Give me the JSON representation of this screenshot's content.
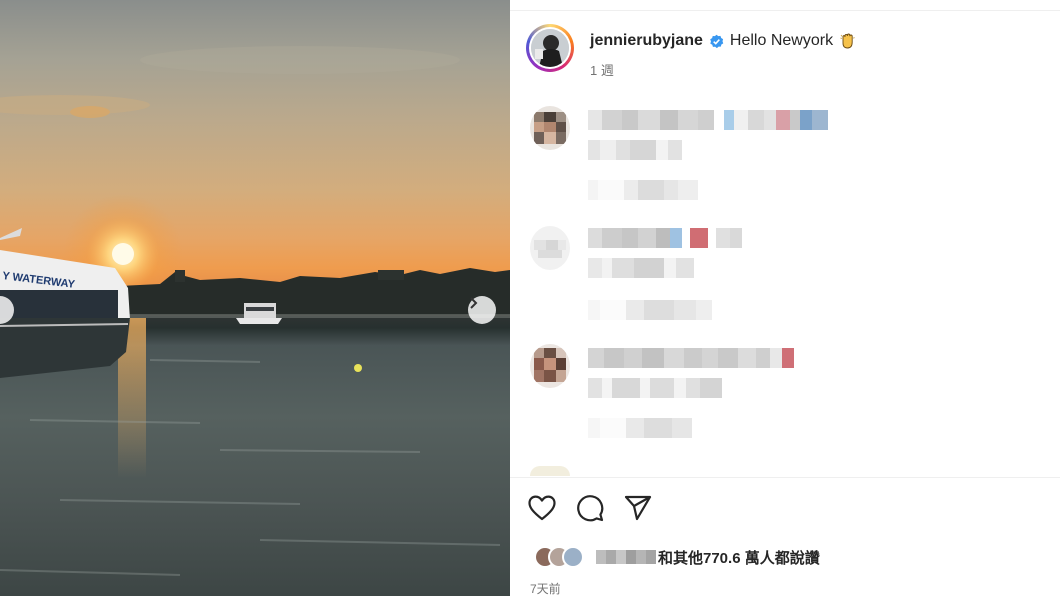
{
  "post": {
    "username": "jennierubyjane",
    "caption": "Hello Newyork",
    "time_ago": "1 週",
    "likes_text": "和其他770.6 萬人都說讚",
    "date": "7天前"
  },
  "media": {
    "ship_text": "Y WATERWAY"
  },
  "icons": {
    "verified": "verified-badge-icon",
    "caption_emoji": "hand-emoji-icon",
    "like": "heart-icon",
    "comment": "comment-bubble-icon",
    "share": "paper-plane-icon",
    "next": "chevron-right-icon",
    "prev": "chevron-left-icon"
  },
  "colors": {
    "verified": "#3897f0",
    "text": "#262626",
    "muted": "#737373"
  }
}
